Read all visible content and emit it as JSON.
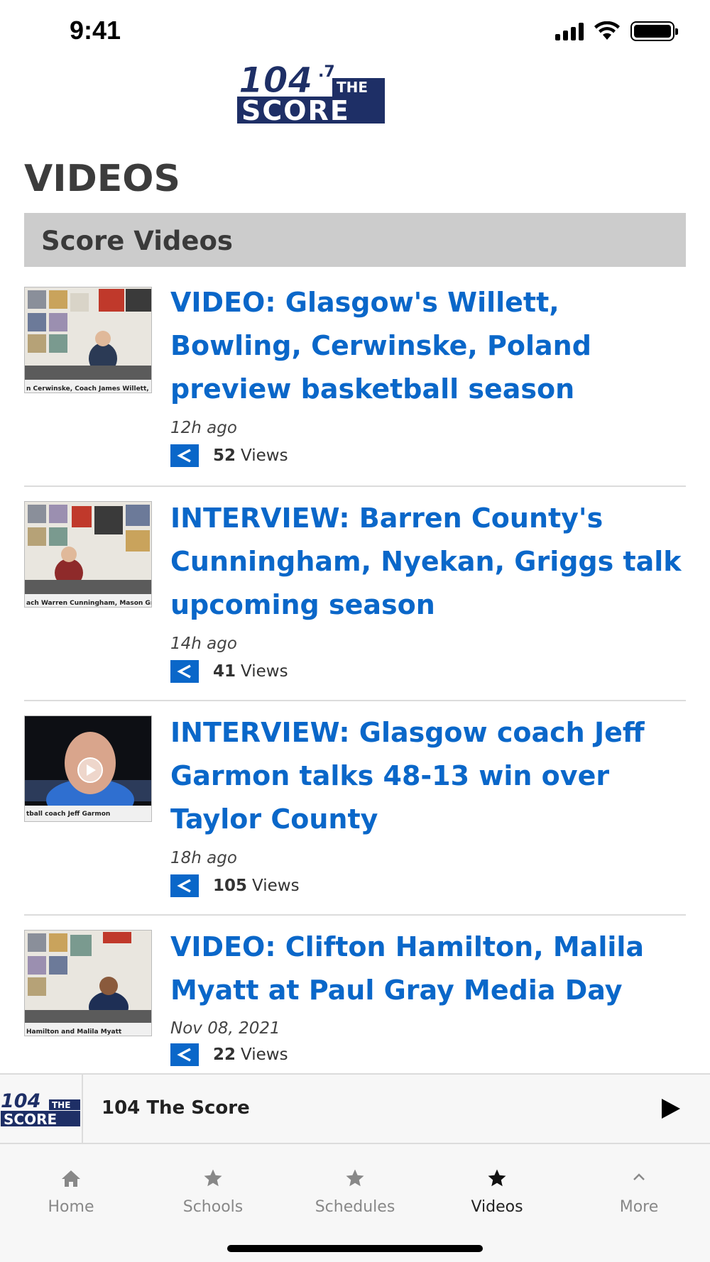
{
  "status_bar": {
    "time": "9:41"
  },
  "header": {
    "logo_alt": "104.7 The Score"
  },
  "page": {
    "title": "VIDEOS",
    "section": "Score Videos"
  },
  "videos": [
    {
      "title": "VIDEO: Glasgow's Willett, Bowling, Cerwinske, Poland preview basketball season",
      "time": "12h ago",
      "views": "52",
      "views_label": "Views",
      "thumb_caption": "n Cerwinske, Coach James Willett,"
    },
    {
      "title": "INTERVIEW: Barren County's Cunningham, Nyekan, Griggs talk upcoming season",
      "time": "14h ago",
      "views": "41",
      "views_label": "Views",
      "thumb_caption": "ach Warren Cunningham, Mason Gri"
    },
    {
      "title": "INTERVIEW: Glasgow coach Jeff Garmon talks 48-13 win over Taylor County",
      "time": "18h ago",
      "views": "105",
      "views_label": "Views",
      "thumb_caption": "tball coach Jeff Garmon"
    },
    {
      "title": "VIDEO: Clifton Hamilton, Malila Myatt at Paul Gray Media Day",
      "time": "Nov 08, 2021",
      "views": "22",
      "views_label": "Views",
      "thumb_caption": "Hamilton and Malila Myatt"
    }
  ],
  "player": {
    "title": "104 The Score"
  },
  "tabs": [
    {
      "label": "Home",
      "icon": "home-icon"
    },
    {
      "label": "Schools",
      "icon": "star-icon"
    },
    {
      "label": "Schedules",
      "icon": "star-icon"
    },
    {
      "label": "Videos",
      "icon": "star-icon",
      "active": true
    },
    {
      "label": "More",
      "icon": "chevron-up-icon"
    }
  ],
  "colors": {
    "link": "#0a67c9",
    "section_bg": "#cccccc",
    "logo_navy": "#1e2f66"
  }
}
